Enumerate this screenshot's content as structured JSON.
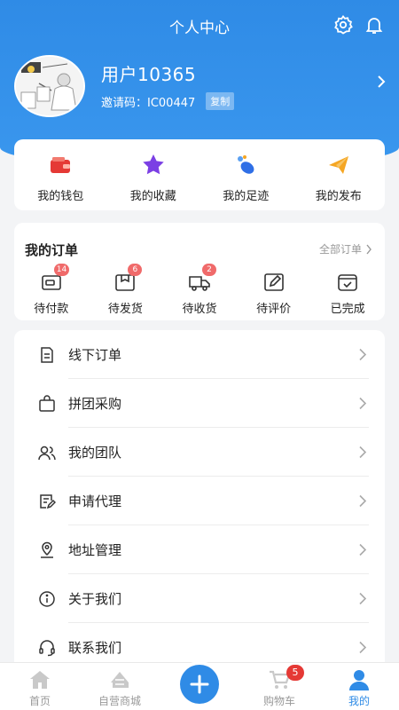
{
  "header": {
    "title": "个人中心"
  },
  "profile": {
    "username": "用户10365",
    "invite_label": "邀请码：IC00447",
    "copy_label": "复制"
  },
  "quick_links": [
    {
      "label": "我的钱包",
      "icon": "wallet-icon",
      "color": "#e53935"
    },
    {
      "label": "我的收藏",
      "icon": "star-icon",
      "color": "#7b3fe4"
    },
    {
      "label": "我的足迹",
      "icon": "footprint-icon",
      "color": "#2f6fe6"
    },
    {
      "label": "我的发布",
      "icon": "paper-plane-icon",
      "color": "#f5a623"
    }
  ],
  "orders": {
    "title": "我的订单",
    "all_label": "全部订单",
    "items": [
      {
        "label": "待付款",
        "icon": "wallet-outline-icon",
        "badge": "14"
      },
      {
        "label": "待发货",
        "icon": "package-icon",
        "badge": "6"
      },
      {
        "label": "待收货",
        "icon": "truck-icon",
        "badge": "2"
      },
      {
        "label": "待评价",
        "icon": "edit-icon",
        "badge": ""
      },
      {
        "label": "已完成",
        "icon": "check-box-icon",
        "badge": ""
      }
    ]
  },
  "menu": [
    {
      "label": "线下订单",
      "icon": "document-icon"
    },
    {
      "label": "拼团采购",
      "icon": "shopping-bag-icon"
    },
    {
      "label": "我的团队",
      "icon": "team-icon"
    },
    {
      "label": "申请代理",
      "icon": "apply-form-icon"
    },
    {
      "label": "地址管理",
      "icon": "location-icon"
    },
    {
      "label": "关于我们",
      "icon": "info-icon"
    },
    {
      "label": "联系我们",
      "icon": "headset-icon"
    }
  ],
  "tabbar": [
    {
      "label": "首页",
      "icon": "home-icon"
    },
    {
      "label": "自营商城",
      "icon": "store-icon"
    },
    {
      "label": "",
      "icon": "plus-icon"
    },
    {
      "label": "购物车",
      "icon": "cart-icon",
      "badge": "5"
    },
    {
      "label": "我的",
      "icon": "user-icon",
      "active": true
    }
  ],
  "colors": {
    "primary": "#2f8be6",
    "badge": "#f06a6a",
    "cart_badge": "#e53935"
  }
}
